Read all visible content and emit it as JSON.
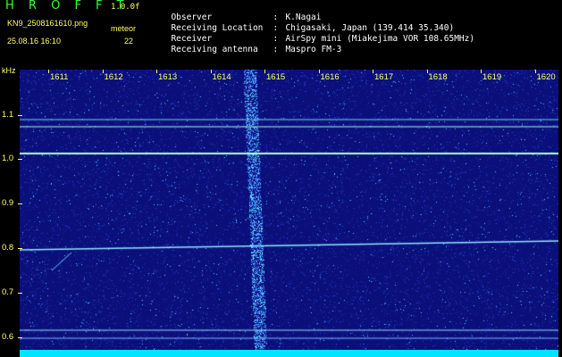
{
  "header": {
    "app_title": "H R O F F T",
    "version": "1.0.0f",
    "filename": "KN9_2508161610.png",
    "mode": "meteor",
    "datetime": "25.08.16 16:10",
    "count": "22"
  },
  "metadata": [
    {
      "label": "Observer",
      "value": "K.Nagai"
    },
    {
      "label": "Receiving Location",
      "value": "Chigasaki, Japan (139.414 35.340)"
    },
    {
      "label": "Receiver",
      "value": "AirSpy mini (Miakejima VOR 108.65MHz)"
    },
    {
      "label": "Receiving antenna",
      "value": "Maspro FM-3"
    }
  ],
  "axis": {
    "y_unit": "kHz",
    "y_ticks": [
      "1.1",
      "1.0",
      "0.9",
      "0.8",
      "0.7",
      "0.6"
    ],
    "x_ticks": [
      "1611",
      "1612",
      "1613",
      "1614",
      "1615",
      "1616",
      "1617",
      "1618",
      "1619",
      "1620"
    ]
  },
  "colors": {
    "background": "#000000",
    "label": "#ffff66",
    "title": "#33ff33",
    "waterfall": "#0b0f7a",
    "strip": "#00e5ff"
  }
}
